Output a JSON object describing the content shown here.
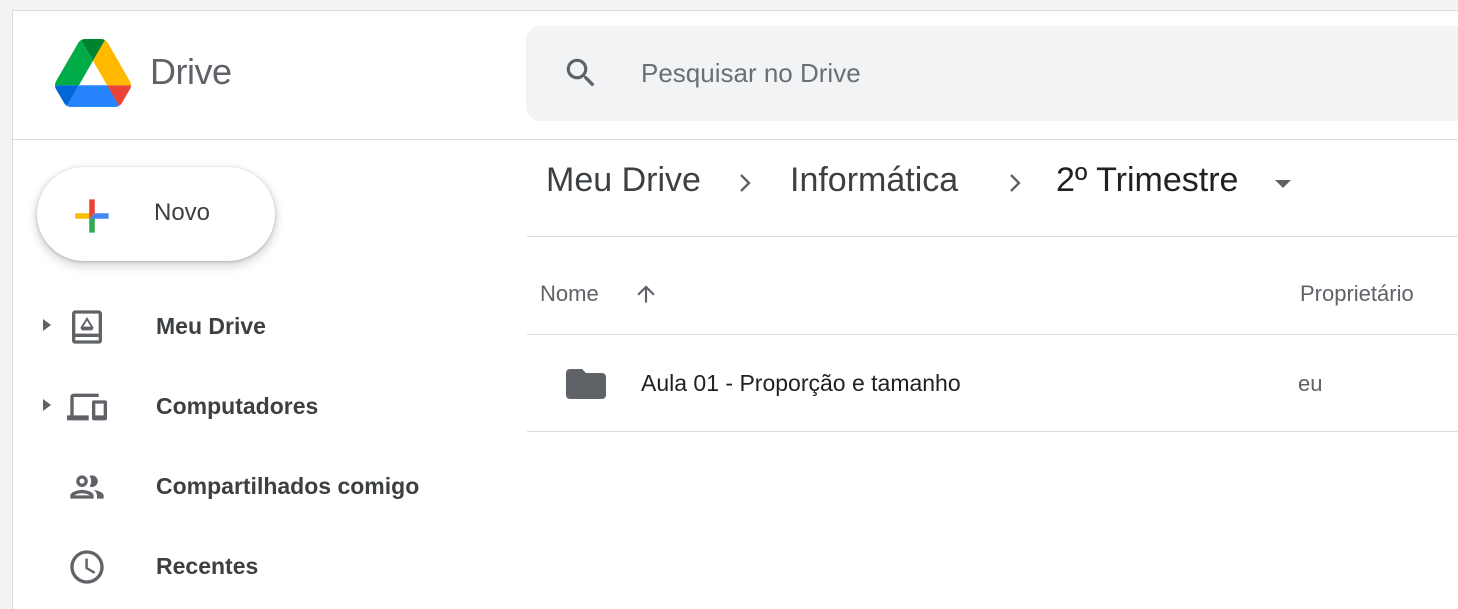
{
  "header": {
    "app_title": "Drive",
    "search": {
      "placeholder": "Pesquisar no Drive"
    }
  },
  "sidebar": {
    "new_button": "Novo",
    "items": [
      {
        "label": "Meu Drive",
        "icon": "my-drive-icon",
        "expandable": true
      },
      {
        "label": "Computadores",
        "icon": "computers-icon",
        "expandable": true
      },
      {
        "label": "Compartilhados comigo",
        "icon": "shared-icon",
        "expandable": false
      },
      {
        "label": "Recentes",
        "icon": "clock-icon",
        "expandable": false
      }
    ]
  },
  "breadcrumb": [
    "Meu Drive",
    "Informática",
    "2º Trimestre"
  ],
  "table": {
    "columns": {
      "name": "Nome",
      "owner": "Proprietário"
    },
    "sort": "ascending",
    "rows": [
      {
        "name": "Aula 01 - Proporção e tamanho",
        "owner": "eu",
        "type": "folder-icon"
      }
    ]
  },
  "colors": {
    "logo_green": "#0f9d58",
    "logo_yellow": "#f4b400",
    "logo_blue": "#4285f4",
    "logo_red": "#ea4335",
    "search_bg": "#f1f3f4",
    "text": "#3c4043"
  }
}
